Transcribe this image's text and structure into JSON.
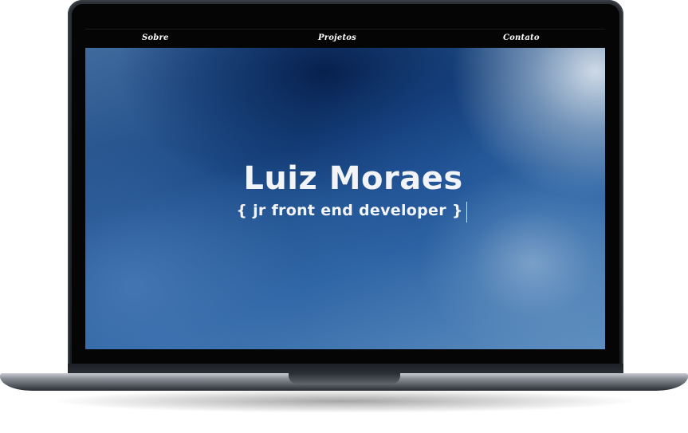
{
  "navbar": {
    "items": [
      {
        "label": "Sobre"
      },
      {
        "label": "Projetos"
      },
      {
        "label": "Contato"
      }
    ]
  },
  "hero": {
    "name": "Luiz Moraes",
    "subtitle": "{ jr front end developer }"
  },
  "colors": {
    "navbar_bg": "#050505",
    "hero_text": "#f2f4f8",
    "hero_accent": "#1c4a86"
  }
}
